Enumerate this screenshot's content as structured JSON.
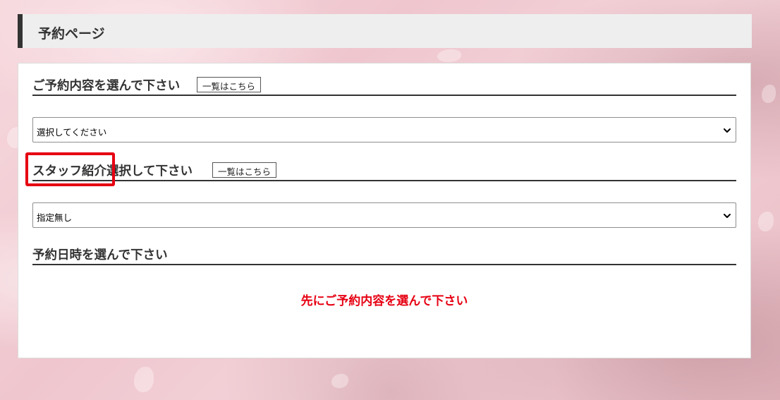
{
  "header": {
    "title": "予約ページ"
  },
  "menu_section": {
    "heading": "ご予約内容を選んで下さい",
    "list_button_label": "一覧はこちら",
    "select_value": "選択してください"
  },
  "staff_section": {
    "heading_highlighted": "スタッフ紹介",
    "heading_rest": "選択して下さい",
    "list_button_label": "一覧はこちら",
    "select_value": "指定無し"
  },
  "datetime_section": {
    "heading": "予約日時を選んで下さい",
    "notice": "先にご予約内容を選んで下さい"
  },
  "colors": {
    "accent_red": "#e60012",
    "header_bar": "#333333",
    "header_bg": "#eeeeee"
  },
  "icons": {
    "select_arrow": "chevron-down-icon"
  }
}
